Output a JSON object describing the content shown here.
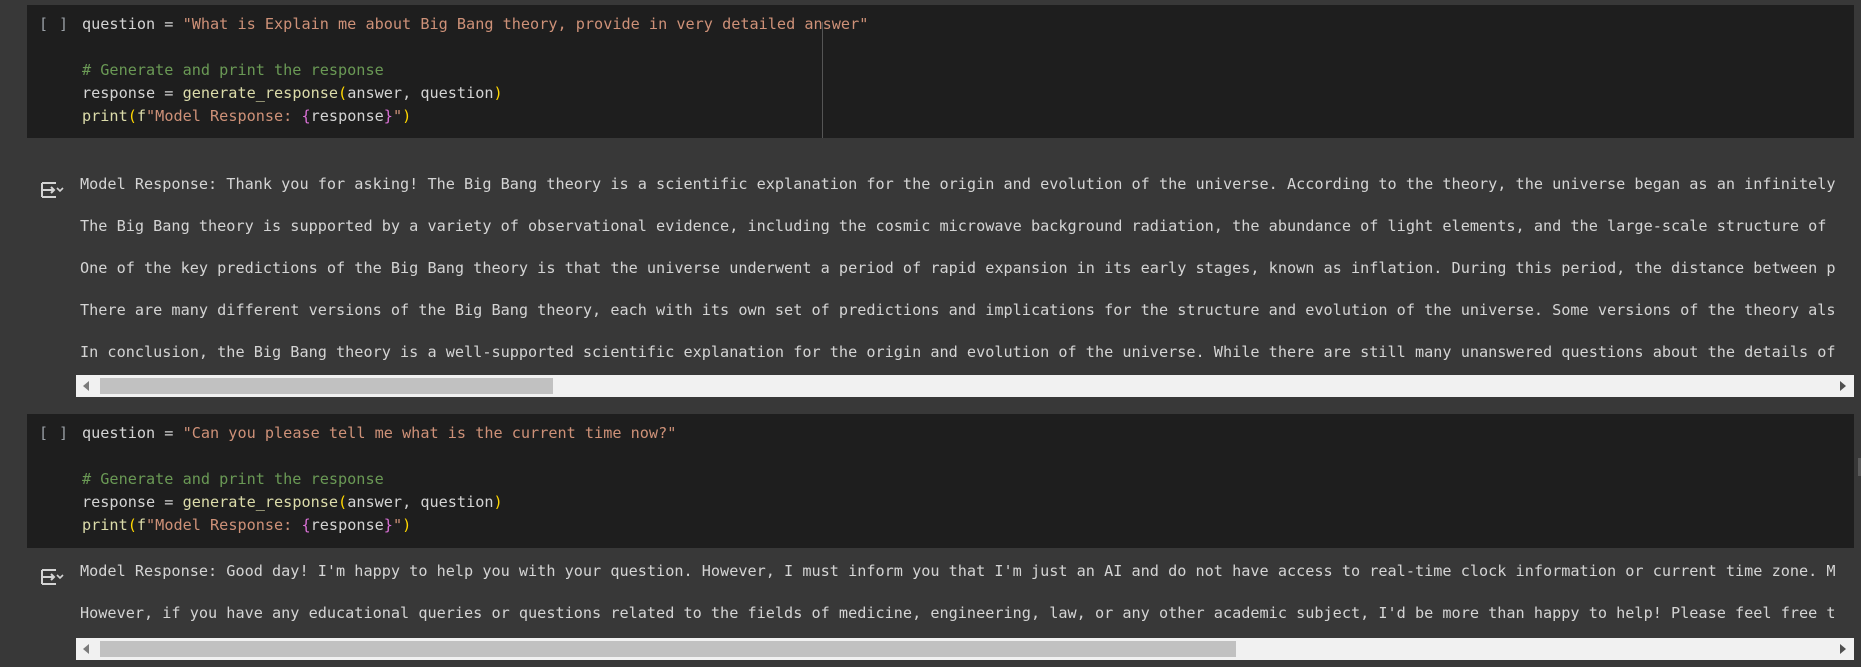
{
  "cells": [
    {
      "run_label": "[ ]",
      "code": {
        "l1_var": "question = ",
        "l1_str": "\"What is Explain me about Big Bang theory, provide in very detailed answer\"",
        "l3_comment": "# Generate and print the response",
        "l4_a": "response = ",
        "l4_fn": "generate_response",
        "l4_open": "(",
        "l4_args": "answer, question",
        "l4_close": ")",
        "l5_fn": "print",
        "l5_open": "(",
        "l5_fprefix": "f",
        "l5_str1": "\"Model Response: ",
        "l5_bopen": "{",
        "l5_var": "response",
        "l5_bclose": "}",
        "l5_str2": "\"",
        "l5_close": ")"
      },
      "output": {
        "icon": "output-expand-icon",
        "lines": [
          "Model Response: Thank you for asking! The Big Bang theory is a scientific explanation for the origin and evolution of the universe. According to the theory, the universe began as an infinitely",
          "The Big Bang theory is supported by a variety of observational evidence, including the cosmic microwave background radiation, the abundance of light elements, and the large-scale structure of",
          "One of the key predictions of the Big Bang theory is that the universe underwent a period of rapid expansion in its early stages, known as inflation. During this period, the distance between p",
          "There are many different versions of the Big Bang theory, each with its own set of predictions and implications for the structure and evolution of the universe. Some versions of the theory als",
          "In conclusion, the Big Bang theory is a well-supported scientific explanation for the origin and evolution of the universe. While there are still many unanswered questions about the details of"
        ],
        "scroll_position_fraction": 0.23
      }
    },
    {
      "run_label": "[ ]",
      "code": {
        "l1_var": "question = ",
        "l1_str": "\"Can you please tell me what is the current time now?\"",
        "l3_comment": "# Generate and print the response",
        "l4_a": "response = ",
        "l4_fn": "generate_response",
        "l4_open": "(",
        "l4_args": "answer, question",
        "l4_close": ")",
        "l5_fn": "print",
        "l5_open": "(",
        "l5_fprefix": "f",
        "l5_str1": "\"Model Response: ",
        "l5_bopen": "{",
        "l5_var": "response",
        "l5_bclose": "}",
        "l5_str2": "\"",
        "l5_close": ")"
      },
      "output": {
        "icon": "output-expand-icon",
        "lines": [
          "Model Response: Good day! I'm happy to help you with your question. However, I must inform you that I'm just an AI and do not have access to real-time clock information or current time zone. M",
          "However, if you have any educational queries or questions related to the fields of medicine, engineering, law, or any other academic subject, I'd be more than happy to help! Please feel free t"
        ],
        "scroll_position_fraction": 0.51
      }
    }
  ],
  "colors": {
    "background": "#383838",
    "cell_background": "#1e1e1e",
    "string": "#ce9178",
    "comment": "#6a9955",
    "function": "#dcdcaa",
    "bracket": "#ffd700",
    "brace": "#da70d6",
    "text": "#d4d4d4"
  }
}
